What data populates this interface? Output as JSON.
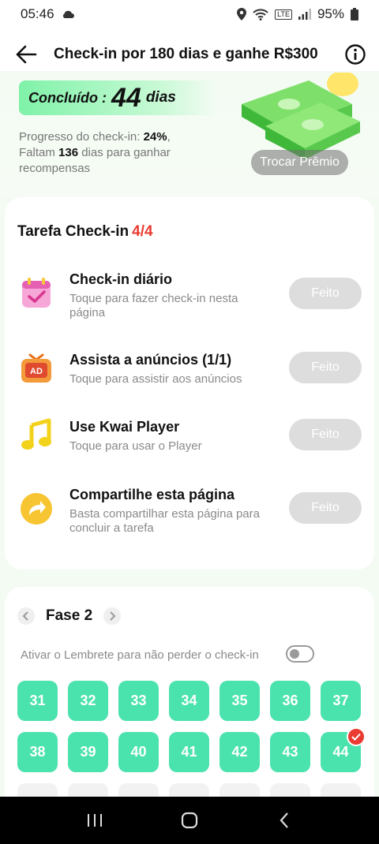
{
  "status_bar": {
    "time": "05:46",
    "battery": "95%",
    "network": "LTE"
  },
  "header": {
    "title": "Check-in por 180 dias e ganhe R$300"
  },
  "hero": {
    "done_label": "Concluído :",
    "done_number": "44",
    "done_unit": "dias",
    "progress_prefix": "Progresso do check-in: ",
    "progress_value": "24%",
    "remaining_prefix": ", Faltam ",
    "remaining_value": "136",
    "remaining_suffix": " dias para ganhar recompensas",
    "redeem_label": "Trocar Prêmio"
  },
  "tasks": {
    "heading": "Tarefa Check-in",
    "count": "4/4",
    "items": [
      {
        "title": "Check-in diário",
        "desc": "Toque para fazer check-in nesta página",
        "button": "Feito",
        "icon": "calendar-icon"
      },
      {
        "title": "Assista a anúncios  (1/1)",
        "desc": "Toque para assistir aos anúncios",
        "button": "Feito",
        "icon": "ad-tv-icon"
      },
      {
        "title": "Use Kwai Player",
        "desc": "Toque para usar o Player",
        "button": "Feito",
        "icon": "music-note-icon"
      },
      {
        "title": "Compartilhe esta página",
        "desc": "Basta compartilhar esta página para concluir a tarefa",
        "button": "Feito",
        "icon": "share-arrow-icon"
      }
    ]
  },
  "phase": {
    "title": "Fase 2",
    "reminder_text": "Ativar o Lembrete para não perder o check-in",
    "reminder_on": false,
    "days": [
      "31",
      "32",
      "33",
      "34",
      "35",
      "36",
      "37",
      "38",
      "39",
      "40",
      "41",
      "42",
      "43",
      "44"
    ],
    "checked_day": "44"
  },
  "colors": {
    "accent": "#4be3ad",
    "highlight": "#ea3b32",
    "done_button": "#dddddd"
  }
}
